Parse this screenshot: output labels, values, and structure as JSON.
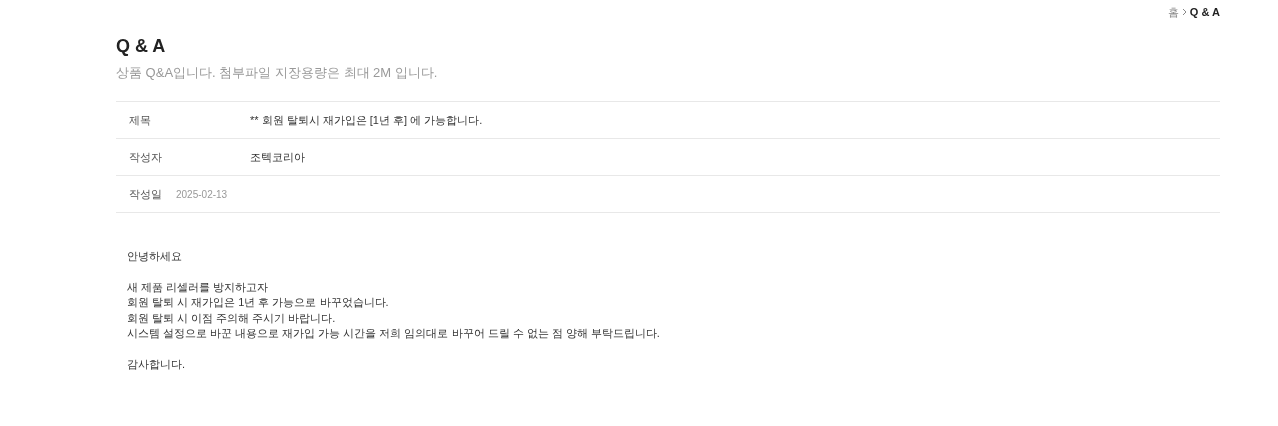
{
  "breadcrumb": [
    {
      "label": "홈",
      "current": false
    },
    {
      "label": "Q & A",
      "current": true
    }
  ],
  "title": "Q & A",
  "subtitle": "상품 Q&A입니다. 첨부파일 지장용량은 최대 2M 입니다.",
  "fields": [
    {
      "label": "제목",
      "value": "** 회원 탈퇴시 재가입은 [1년 후] 에 가능합니다.",
      "kind": "text"
    },
    {
      "label": "작성자",
      "value": "조텍코리아",
      "kind": "text"
    },
    {
      "label": "작성일",
      "value": "2025-02-13",
      "kind": "date"
    }
  ],
  "body": [
    [
      "안녕하세요"
    ],
    [
      "새 제품 리셀러를 방지하고자",
      "회원 탈퇴 시 재가입은 1년 후 가능으로 바꾸었습니다.",
      "회원 탈퇴 시 이점 주의해 주시기 바랍니다.",
      "시스템 설정으로 바꾼 내용으로 재가입 가능 시간을 저희 임의대로 바꾸어 드릴 수 없는 점 양해 부탁드립니다."
    ],
    [
      "감사합니다."
    ]
  ]
}
